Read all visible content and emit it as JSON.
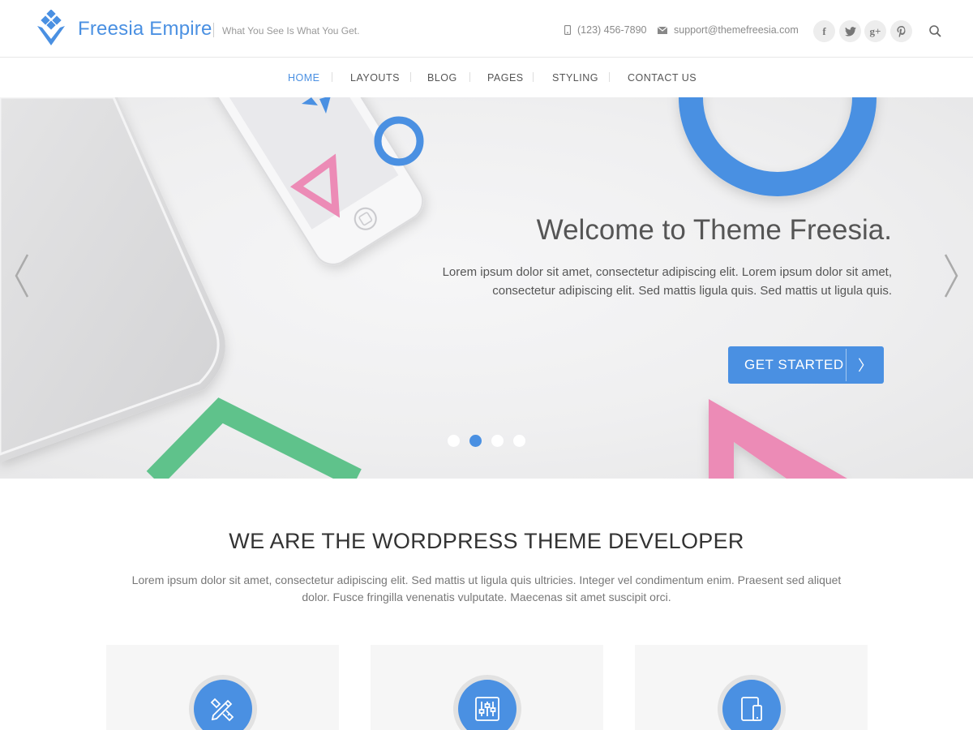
{
  "header": {
    "site_title": "Freesia Empire",
    "tagline": "What You See Is What You Get.",
    "phone": "(123) 456-7890",
    "email": "support@themefreesia.com",
    "social": [
      {
        "name": "facebook",
        "glyph": "f"
      },
      {
        "name": "twitter",
        "glyph": "t"
      },
      {
        "name": "google-plus",
        "glyph": "g+"
      },
      {
        "name": "pinterest",
        "glyph": "p"
      }
    ]
  },
  "nav": {
    "items": [
      "HOME",
      "LAYOUTS",
      "BLOG",
      "PAGES",
      "STYLING",
      "CONTACT US"
    ],
    "active": "HOME"
  },
  "hero": {
    "title": "Welcome to Theme Freesia.",
    "text": "Lorem ipsum dolor sit amet, consectetur adipiscing elit. Lorem ipsum dolor sit amet, consectetur adipiscing elit. Sed mattis ligula quis. Sed mattis ut ligula quis.",
    "cta_label": "GET STARTED",
    "cta_arrow": "〉",
    "slide_count": 4,
    "active_slide": 2
  },
  "about": {
    "title": "WE ARE THE WORDPRESS THEME DEVELOPER",
    "text": "Lorem ipsum dolor sit amet, consectetur adipiscing elit. Sed mattis ut ligula quis ultricies. Integer vel condimentum enim. Praesent sed aliquet dolor. Fusce fringilla venenatis vulputate. Maecenas sit amet suscipit orci."
  },
  "features": [
    {
      "icon": "design-tools-icon"
    },
    {
      "icon": "sliders-icon"
    },
    {
      "icon": "devices-icon"
    }
  ],
  "colors": {
    "accent": "#4a90e2",
    "pink": "#ec8bb6",
    "green": "#5fc28b"
  }
}
